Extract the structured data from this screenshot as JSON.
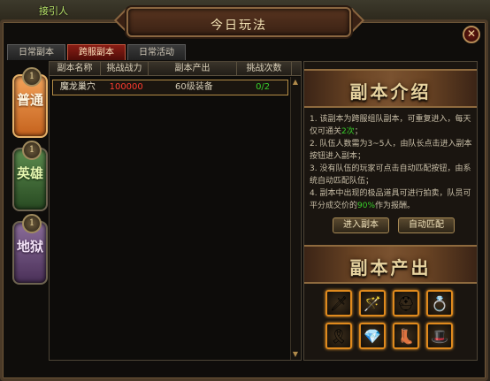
{
  "world": {
    "npc_name": "接引人"
  },
  "window": {
    "title": "今日玩法",
    "close_glyph": "✕"
  },
  "tabs": [
    {
      "label": "日常副本",
      "active": false
    },
    {
      "label": "跨服副本",
      "active": true
    },
    {
      "label": "日常活动",
      "active": false
    }
  ],
  "categories": [
    {
      "badge": "1",
      "label": "普通",
      "selected": true
    },
    {
      "badge": "1",
      "label": "英雄",
      "selected": false
    },
    {
      "badge": "1",
      "label": "地狱",
      "selected": false
    }
  ],
  "table": {
    "headers": [
      "副本名称",
      "挑战战力",
      "副本产出",
      "挑战次数"
    ],
    "rows": [
      {
        "name": "魔龙巢穴",
        "power": "100000",
        "output": "60级装备",
        "attempts": "0/2"
      }
    ]
  },
  "scroll": {
    "up": "▲",
    "down": "▼"
  },
  "intro": {
    "heading": "副本介绍",
    "lines": [
      {
        "before": "1. 该副本为跨服组队副本，可重复进入，每天仅可通关",
        "hl": "2次",
        "after": "；"
      },
      {
        "before": "2. 队伍人数需为3~5人，由队长点击进入副本按钮进入副本；",
        "hl": "",
        "after": ""
      },
      {
        "before": "3. 没有队伍的玩家可点击自动匹配按钮，由系统自动匹配队伍；",
        "hl": "",
        "after": ""
      },
      {
        "before": "4. 副本中出现的极品道具可进行拍卖，队员可平分成交价的",
        "hl": "90%",
        "after": "作为报酬。"
      }
    ]
  },
  "buttons": {
    "enter": "进入副本",
    "auto_match": "自动匹配"
  },
  "drops": {
    "heading": "副本产出",
    "items": [
      {
        "icon": "blade-icon",
        "glyph": "🗡"
      },
      {
        "icon": "staff-icon",
        "glyph": "🪄"
      },
      {
        "icon": "helmet-icon",
        "glyph": "⛑"
      },
      {
        "icon": "ring-icon",
        "glyph": "💍"
      },
      {
        "icon": "belt-icon",
        "glyph": "🎗"
      },
      {
        "icon": "gem-icon",
        "glyph": "💎"
      },
      {
        "icon": "boots-icon",
        "glyph": "👢"
      },
      {
        "icon": "hat-icon",
        "glyph": "🎩"
      }
    ]
  },
  "colors": {
    "accent_red": "#ff3b2e",
    "accent_green": "#39d02a",
    "gold_border": "#e08a1d"
  }
}
